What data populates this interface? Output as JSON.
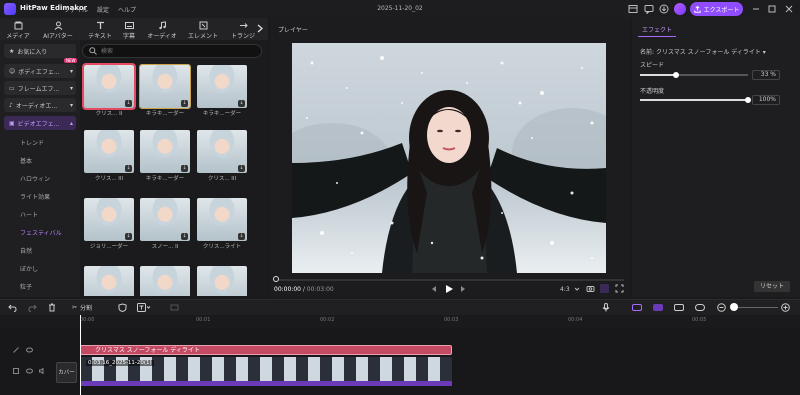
{
  "titlebar": {
    "app_name": "HitPaw Edimakor",
    "menu": [
      "ファイル",
      "設定",
      "ヘルプ"
    ],
    "project": "2025-11-20_02",
    "export_label": "エクスポート"
  },
  "tools": [
    {
      "label": "メディア",
      "icon": "media-icon"
    },
    {
      "label": "AIアバター",
      "icon": "ai-avatar-icon"
    },
    {
      "label": "テキスト",
      "icon": "text-icon"
    },
    {
      "label": "字幕",
      "icon": "subtitle-icon"
    },
    {
      "label": "オーディオ",
      "icon": "audio-icon"
    },
    {
      "label": "エレメント",
      "icon": "element-icon"
    },
    {
      "label": "トランジ",
      "icon": "transition-icon"
    }
  ],
  "categories": [
    {
      "label": "お気に入り",
      "icon": "star-icon"
    },
    {
      "label": "ボディエフェ...",
      "icon": "body-effect-icon",
      "badge": "NEW"
    },
    {
      "label": "フレームエフ...",
      "icon": "frame-effect-icon"
    },
    {
      "label": "オーディオエ...",
      "icon": "audio-effect-icon"
    },
    {
      "label": "ビデオエフェ...",
      "icon": "video-effect-icon"
    }
  ],
  "subcategories": [
    "トレンド",
    "基本",
    "ハロウィン",
    "ライト効果",
    "ハート",
    "フェスティバル",
    "自然",
    "ぼかし",
    "粒子"
  ],
  "active_subcategory": "フェスティバル",
  "search": {
    "placeholder": "検索"
  },
  "thumbnails": [
    "クリス... II",
    "キラキ...ーダー",
    "キラキ...ーダー",
    "クリス... III",
    "キラキ...ーダー",
    "クリス... III",
    "ジョリ...ーダー",
    "スノー... II",
    "クリス...ライト",
    "",
    "",
    ""
  ],
  "player": {
    "label": "プレイヤー",
    "current_time": "00:00:00",
    "total_time": "00:03:00",
    "ratio": "4:3"
  },
  "effect_panel": {
    "tab": "エフェクト",
    "name_label": "名前:",
    "name": "クリスマス スノーフォール ディライト",
    "speed_label": "スピード",
    "speed_value": "33 %",
    "speed_level": 0.33,
    "opacity_label": "不透明度",
    "opacity_value": "100%",
    "opacity_level": 1.0,
    "reset_label": "リセット"
  },
  "timeline": {
    "split_label": "分割",
    "ruler": [
      "00:00",
      "00:01",
      "00:02",
      "00:03",
      "00:04",
      "00:05"
    ],
    "effect_clip": "クリスマス スノーフォール ディライト",
    "video_clip": "0:03:16_2025-11-20(1)",
    "cover_label": "カバー"
  }
}
